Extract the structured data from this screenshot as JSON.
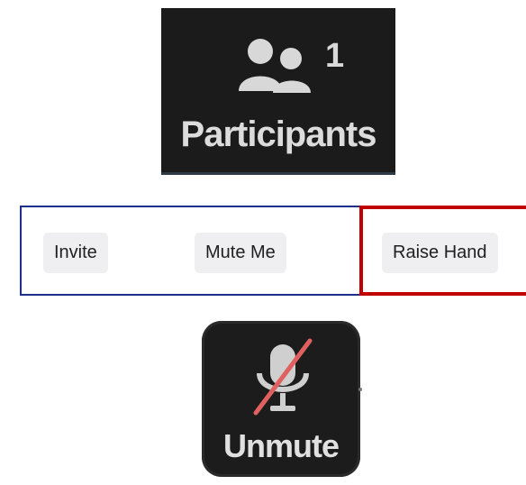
{
  "participants_panel": {
    "count": "1",
    "label": "Participants",
    "icon": "people-icon",
    "background": "#1b1b1b"
  },
  "toolbar": {
    "buttons": [
      {
        "label": "Invite"
      },
      {
        "label": "Mute Me"
      },
      {
        "label": "Raise Hand"
      }
    ],
    "frame_colors": {
      "blue": "#1c2f8a",
      "red": "#c00000"
    }
  },
  "unmute_button": {
    "label": "Unmute",
    "icon": "muted-microphone-icon",
    "slash_color": "#e06060"
  }
}
